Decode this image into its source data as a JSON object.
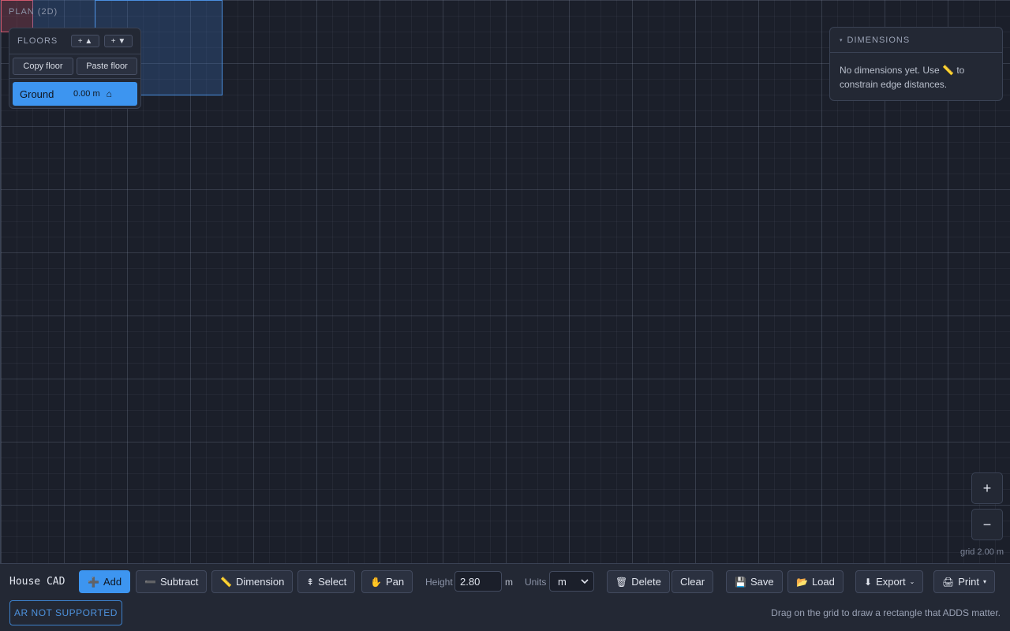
{
  "canvas": {
    "view_label": "PLAN (2D)",
    "grid_label": "grid 2.00 m"
  },
  "floors": {
    "title": "FLOORS",
    "add_above": "+ ▲",
    "add_below": "+ ▼",
    "copy_label": "Copy floor",
    "paste_label": "Paste floor",
    "items": [
      {
        "name": "Ground",
        "elevation": "0.00 m",
        "icon": "home-icon",
        "glyph": "⌂",
        "active": true
      }
    ]
  },
  "dimensions": {
    "caret": "▾",
    "title": "DIMENSIONS",
    "empty_text": "No dimensions yet. Use 📏 to constrain edge distances."
  },
  "zoom": {
    "in": "+",
    "out": "−"
  },
  "toolbar": {
    "app_title": "House CAD",
    "add": {
      "icon": "➕",
      "label": "Add"
    },
    "subtract": {
      "icon": "➖",
      "label": "Subtract"
    },
    "dimension": {
      "icon": "📏",
      "label": "Dimension"
    },
    "select": {
      "icon": "⇞",
      "label": "Select"
    },
    "pan": {
      "icon": "✋",
      "label": "Pan"
    },
    "height_label": "Height",
    "height_value": "2.80",
    "height_unit": "m",
    "units_label": "Units",
    "units_value": "m",
    "delete": {
      "icon": "🗑",
      "label": "Delete"
    },
    "clear": "Clear",
    "save": {
      "icon": "💾",
      "label": "Save"
    },
    "load": {
      "icon": "📂",
      "label": "Load"
    },
    "export": {
      "icon": "⬇",
      "label": "Export",
      "caret": "⌄"
    },
    "print": {
      "icon": "🖨",
      "label": "Print",
      "caret": "▾"
    },
    "ar_label": "AR NOT SUPPORTED",
    "hint": "Drag on the grid to draw a rectangle that ADDS matter."
  },
  "colors": {
    "accent": "#3d95f0",
    "shape_add": "#4a8fe0",
    "shape_subtract": "#d0586e",
    "background": "#1b1f2a"
  }
}
